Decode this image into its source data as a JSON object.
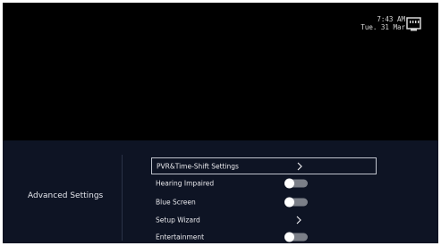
{
  "status": {
    "time": "7:43 AM",
    "date": "Tue. 31 Mar",
    "network_icon": "ethernet-icon"
  },
  "panel": {
    "title": "Advanced Settings"
  },
  "menu": {
    "items": [
      {
        "label": "PVR&Time-Shift Settings",
        "control": "chevron",
        "selected": true
      },
      {
        "label": "Hearing Impaired",
        "control": "toggle",
        "state": "off"
      },
      {
        "label": "Blue Screen",
        "control": "toggle",
        "state": "off"
      },
      {
        "label": "Setup Wizard",
        "control": "chevron"
      },
      {
        "label": "Entertainment",
        "control": "toggle",
        "state": "off"
      }
    ]
  },
  "colors": {
    "background": "#000000",
    "panel": "#0e1424",
    "toggle_off_track": "#7b7f88",
    "selection_border": "#bfc3cc"
  }
}
